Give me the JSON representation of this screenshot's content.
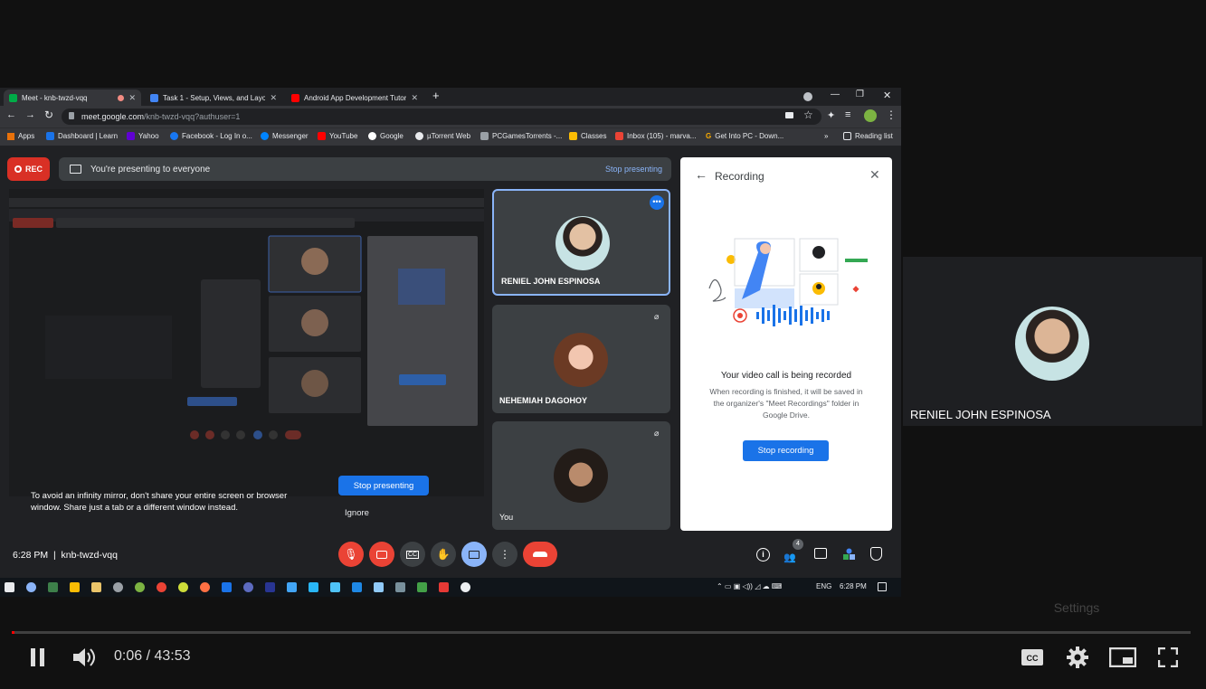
{
  "browser": {
    "tabs": [
      {
        "title": "Meet - knb-twzd-vqq",
        "active": true
      },
      {
        "title": "Task 1 - Setup, Views, and Layou"
      },
      {
        "title": "Android App Development Tutor"
      }
    ],
    "url_host": "meet.google.com",
    "url_path": "/knb-twzd-vqq?authuser=1",
    "bookmarks": [
      "Apps",
      "Dashboard | Learn",
      "Yahoo",
      "Facebook - Log In o...",
      "Messenger",
      "YouTube",
      "Google",
      "µTorrent Web",
      "PCGamesTorrents -...",
      "Classes",
      "Inbox (105) - marva...",
      "Get Into PC - Down..."
    ],
    "bookmarks_more": "»",
    "reading_list": "Reading list"
  },
  "meet": {
    "rec_label": "REC",
    "presenting_text": "You're presenting to everyone",
    "stop_presenting_link": "Stop presenting",
    "infinity_warning_1": "To avoid an infinity mirror, don't share your entire screen or browser",
    "infinity_warning_2": "window. Share just a tab or a different window instead.",
    "stop_presenting_button": "Stop presenting",
    "ignore": "Ignore",
    "participants": [
      {
        "name": "RENIEL JOHN ESPINOSA"
      },
      {
        "name": "NEHEMIAH DAGOHOY"
      },
      {
        "name": "You"
      }
    ],
    "time_code": "6:28 PM  |  knb-twzd-vqq",
    "people_count": "4",
    "recording_panel": {
      "title": "Recording",
      "heading": "Your video call is being recorded",
      "body_1": "When recording is finished, it will be saved in",
      "body_2": "the organizer's \"Meet Recordings\" folder in",
      "body_3": "Google Drive.",
      "stop_button": "Stop recording"
    }
  },
  "taskbar": {
    "lang": "ENG",
    "clock": "6:28 PM"
  },
  "side_video": {
    "name": "RENIEL JOHN ESPINOSA"
  },
  "player": {
    "time": "0:06 / 43:53",
    "progress": 0.002,
    "settings_tooltip": "Settings"
  },
  "colors": {
    "record_red": "#d93025",
    "meet_blue": "#1a73e8",
    "end_call_red": "#ea4335",
    "link_blue": "#8ab4f8"
  }
}
